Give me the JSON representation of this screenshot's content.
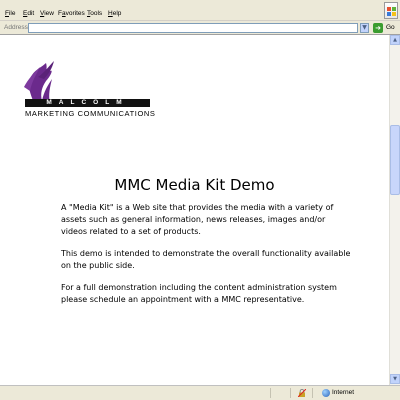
{
  "menu": {
    "file": {
      "hot": "F",
      "rest": "ile"
    },
    "edit": {
      "hot": "E",
      "rest": "dit"
    },
    "view": {
      "hot": "V",
      "rest": "iew"
    },
    "favorites": {
      "pre": "F",
      "hot": "a",
      "rest": "vorites"
    },
    "tools": {
      "hot": "T",
      "rest": "ools"
    },
    "help": {
      "hot": "H",
      "rest": "elp"
    }
  },
  "address": {
    "label": "Address",
    "value": "",
    "go_label": "Go"
  },
  "logo": {
    "wordmark": "MALCOLM",
    "tagline": "MARKETING COMMUNICATIONS"
  },
  "page": {
    "title": "MMC Media Kit Demo",
    "paragraphs": [
      "A \"Media Kit\" is a Web site that provides the media with a variety of assets such as general information, news releases, images and/or videos related to a set of products.",
      "This demo is intended to demonstrate the overall functionality available on the public side.",
      "For a full demonstration including the content administration system please schedule an appointment with a MMC representative."
    ]
  },
  "status": {
    "zone_label": "Internet"
  },
  "colors": {
    "logo_purple": "#6b2a8c",
    "chrome": "#ece9d8",
    "go_green": "#3a9c2f"
  },
  "icons": {
    "zone": "globe-icon",
    "security": "lock-icon",
    "go": "go-arrow-icon",
    "windows": "windows-logo-icon"
  }
}
